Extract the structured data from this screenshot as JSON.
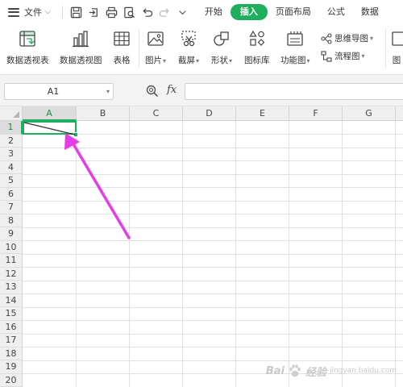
{
  "menubar": {
    "file_label": "文件",
    "tabs": [
      {
        "label": "开始",
        "active": false
      },
      {
        "label": "插入",
        "active": true
      },
      {
        "label": "页面布局",
        "active": false
      },
      {
        "label": "公式",
        "active": false
      },
      {
        "label": "数据",
        "active": false
      }
    ]
  },
  "ribbon": {
    "pivot_table": "数据透视表",
    "pivot_chart": "数据透视图",
    "table": "表格",
    "picture": "图片",
    "screenshot": "截屏",
    "shapes": "形状",
    "icon_library": "图标库",
    "function_chart": "功能图",
    "mind_map": "思维导图",
    "flowchart": "流程图",
    "cut_off": "图"
  },
  "formula_bar": {
    "name_box_value": "A1",
    "fx_label": "fx",
    "formula_value": ""
  },
  "grid": {
    "columns": [
      "A",
      "B",
      "C",
      "D",
      "E",
      "F",
      "G"
    ],
    "rows": [
      "1",
      "2",
      "3",
      "4",
      "5",
      "6",
      "7",
      "8",
      "9",
      "10",
      "11",
      "12",
      "13",
      "14",
      "15",
      "16",
      "17",
      "18",
      "19",
      "20"
    ],
    "selected_cell": "A1",
    "selected_column": "A",
    "selected_row": "1"
  },
  "annotation": {
    "arrow_color": "#e83be8"
  },
  "watermark": {
    "text_left": "Bai",
    "text_right": "经验",
    "sub": "jingyan.baidu.com"
  },
  "colors": {
    "accent": "#1fae5e"
  }
}
